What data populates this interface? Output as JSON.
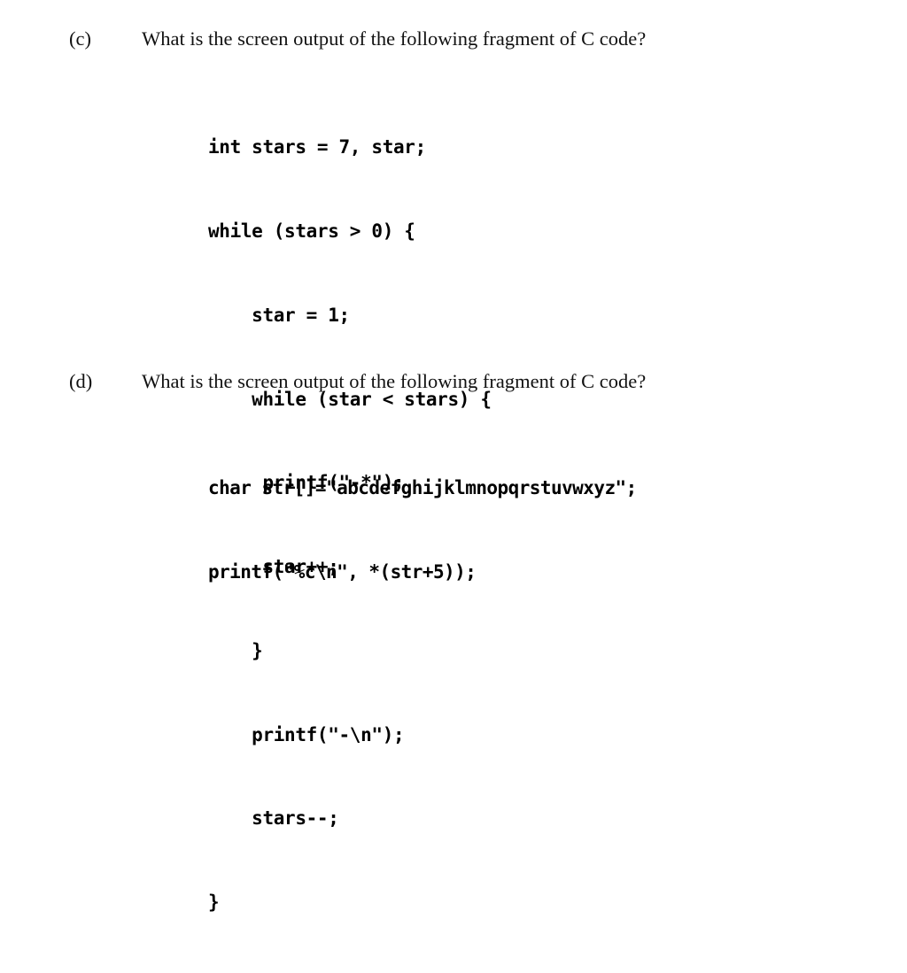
{
  "document": {
    "background_color": "#ffffff",
    "text_color": "#000000"
  },
  "questions": [
    {
      "label": "(c)",
      "prompt": "What is the screen output of the following fragment of C code?",
      "code_lines": [
        "int stars = 7, star;",
        "while (stars > 0) {",
        "    star = 1;",
        "    while (star < stars) {",
        "     printf(\"-*\");",
        "     star++;",
        "    }",
        "    printf(\"-\\n\");",
        "    stars--;",
        "}"
      ]
    },
    {
      "label": "(d)",
      "prompt": "What is the screen output of the following fragment of C code?",
      "code_lines": [
        "char str[]=\"abcdefghijklmnopqrstuvwxyz\";",
        "printf(\"%c\\n\", *(str+5));"
      ]
    }
  ]
}
